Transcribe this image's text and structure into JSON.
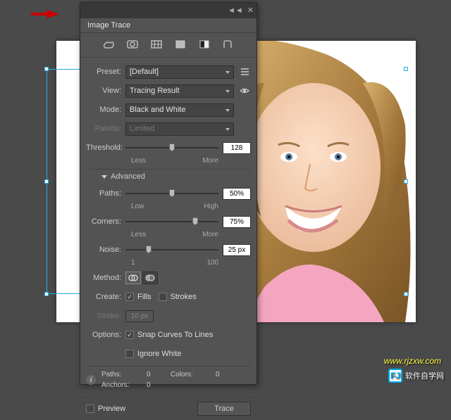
{
  "panel_title": "Image Trace",
  "preset": {
    "label": "Preset:",
    "value": "[Default]"
  },
  "view": {
    "label": "View:",
    "value": "Tracing Result"
  },
  "mode": {
    "label": "Mode:",
    "value": "Black and White"
  },
  "palette": {
    "label": "Palette:",
    "value": "Limited"
  },
  "threshold": {
    "label": "Threshold:",
    "value": "128",
    "low": "Less",
    "high": "More",
    "pct": 50
  },
  "advanced": "Advanced",
  "paths": {
    "label": "Paths:",
    "value": "50%",
    "low": "Low",
    "high": "High",
    "pct": 50
  },
  "corners": {
    "label": "Corners:",
    "value": "75%",
    "low": "Less",
    "high": "More",
    "pct": 75
  },
  "noise": {
    "label": "Noise:",
    "value": "25 px",
    "low": "1",
    "high": "100",
    "pct": 25
  },
  "method": {
    "label": "Method:"
  },
  "create": {
    "label": "Create:",
    "fills": "Fills",
    "strokes": "Strokes"
  },
  "stroke": {
    "label": "Stroke:",
    "value": "10 px"
  },
  "options": {
    "label": "Options:",
    "snap": "Snap Curves To Lines",
    "ignore": "Ignore White"
  },
  "info": {
    "paths_l": "Paths:",
    "paths_v": "0",
    "colors_l": "Colors:",
    "colors_v": "0",
    "anchors_l": "Anchors:",
    "anchors_v": "0"
  },
  "preview": "Preview",
  "trace": "Trace",
  "logo_text": "软件自学网",
  "url": "www.rjzxw.com"
}
